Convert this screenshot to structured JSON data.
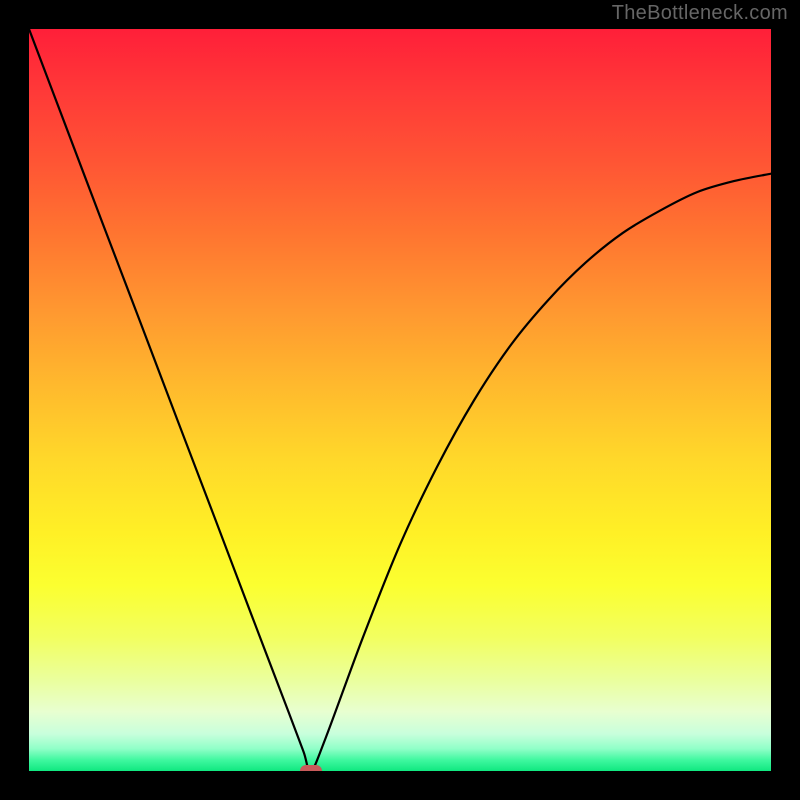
{
  "watermark": "TheBottleneck.com",
  "chart_data": {
    "type": "line",
    "title": "",
    "xlabel": "",
    "ylabel": "",
    "xlim": [
      0,
      100
    ],
    "ylim": [
      0,
      100
    ],
    "grid": false,
    "legend": false,
    "gradient": {
      "stops": [
        {
          "pos": 0,
          "color": "#ff1f39",
          "meaning": "high-bottleneck"
        },
        {
          "pos": 50,
          "color": "#ffd82a",
          "meaning": "mid"
        },
        {
          "pos": 100,
          "color": "#10e880",
          "meaning": "no-bottleneck"
        }
      ]
    },
    "series": [
      {
        "name": "bottleneck-curve",
        "x": [
          0,
          5,
          10,
          15,
          20,
          25,
          30,
          35,
          37,
          38,
          40,
          45,
          50,
          55,
          60,
          65,
          70,
          75,
          80,
          85,
          90,
          95,
          100
        ],
        "y": [
          100,
          86.8,
          73.6,
          60.5,
          47.3,
          34.2,
          21,
          7.9,
          2.6,
          0,
          4.5,
          18,
          30.5,
          41,
          50,
          57.5,
          63.5,
          68.5,
          72.5,
          75.5,
          78,
          79.5,
          80.5
        ]
      }
    ],
    "marker": {
      "name": "current-balance-point",
      "x": 38,
      "y": 0,
      "color": "#c85a5a"
    }
  }
}
